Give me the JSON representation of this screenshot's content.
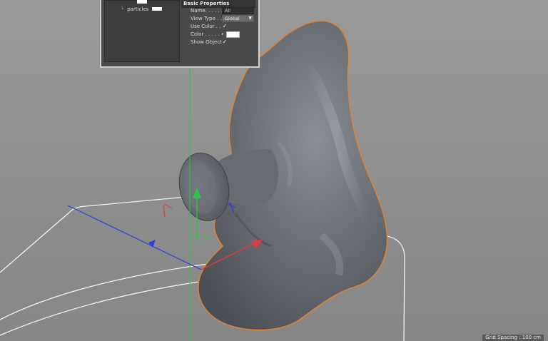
{
  "object_manager": {
    "item_top_label": "",
    "item_particles_label": "particles"
  },
  "attributes": {
    "section_title": "Basic Properties",
    "name_label": "Name. . . . . . .",
    "name_value": "All",
    "view_type_label": "View Type . .",
    "view_type_value": "Global",
    "use_color_label": "Use Color . . .",
    "use_color_checked": "✓",
    "color_label": "Color . . . . .",
    "color_value": "#ffffff",
    "show_object_label": "Show Object",
    "show_object_checked": "✓"
  },
  "viewport": {
    "grid_spacing": "Grid Spacing : 100 cm",
    "colors": {
      "background": "#8f8f8f",
      "mesh": "#6e7177",
      "selection_outline": "#d9843a",
      "axis_x": "#e23b3b",
      "axis_y": "#2fc24a",
      "axis_z": "#2f3ddb",
      "spline": "#f0f0f0"
    }
  }
}
